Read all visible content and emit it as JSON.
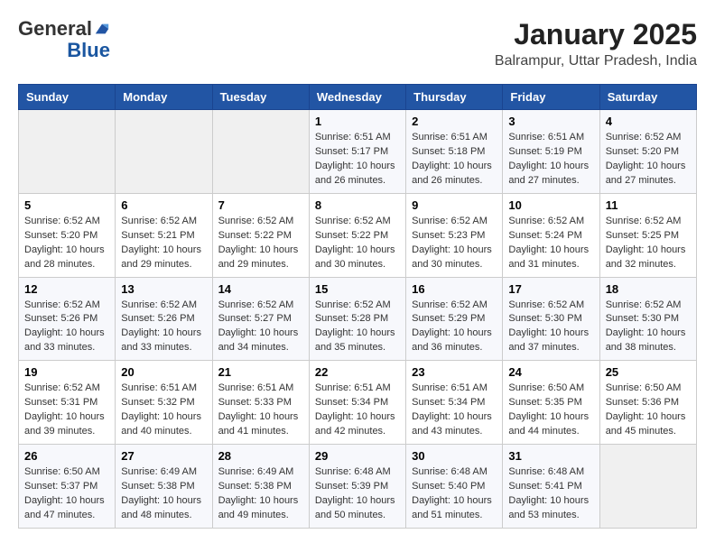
{
  "header": {
    "logo_general": "General",
    "logo_blue": "Blue",
    "month_year": "January 2025",
    "location": "Balrampur, Uttar Pradesh, India"
  },
  "days_of_week": [
    "Sunday",
    "Monday",
    "Tuesday",
    "Wednesday",
    "Thursday",
    "Friday",
    "Saturday"
  ],
  "weeks": [
    [
      {
        "day": "",
        "info": ""
      },
      {
        "day": "",
        "info": ""
      },
      {
        "day": "",
        "info": ""
      },
      {
        "day": "1",
        "info": "Sunrise: 6:51 AM\nSunset: 5:17 PM\nDaylight: 10 hours\nand 26 minutes."
      },
      {
        "day": "2",
        "info": "Sunrise: 6:51 AM\nSunset: 5:18 PM\nDaylight: 10 hours\nand 26 minutes."
      },
      {
        "day": "3",
        "info": "Sunrise: 6:51 AM\nSunset: 5:19 PM\nDaylight: 10 hours\nand 27 minutes."
      },
      {
        "day": "4",
        "info": "Sunrise: 6:52 AM\nSunset: 5:20 PM\nDaylight: 10 hours\nand 27 minutes."
      }
    ],
    [
      {
        "day": "5",
        "info": "Sunrise: 6:52 AM\nSunset: 5:20 PM\nDaylight: 10 hours\nand 28 minutes."
      },
      {
        "day": "6",
        "info": "Sunrise: 6:52 AM\nSunset: 5:21 PM\nDaylight: 10 hours\nand 29 minutes."
      },
      {
        "day": "7",
        "info": "Sunrise: 6:52 AM\nSunset: 5:22 PM\nDaylight: 10 hours\nand 29 minutes."
      },
      {
        "day": "8",
        "info": "Sunrise: 6:52 AM\nSunset: 5:22 PM\nDaylight: 10 hours\nand 30 minutes."
      },
      {
        "day": "9",
        "info": "Sunrise: 6:52 AM\nSunset: 5:23 PM\nDaylight: 10 hours\nand 30 minutes."
      },
      {
        "day": "10",
        "info": "Sunrise: 6:52 AM\nSunset: 5:24 PM\nDaylight: 10 hours\nand 31 minutes."
      },
      {
        "day": "11",
        "info": "Sunrise: 6:52 AM\nSunset: 5:25 PM\nDaylight: 10 hours\nand 32 minutes."
      }
    ],
    [
      {
        "day": "12",
        "info": "Sunrise: 6:52 AM\nSunset: 5:26 PM\nDaylight: 10 hours\nand 33 minutes."
      },
      {
        "day": "13",
        "info": "Sunrise: 6:52 AM\nSunset: 5:26 PM\nDaylight: 10 hours\nand 33 minutes."
      },
      {
        "day": "14",
        "info": "Sunrise: 6:52 AM\nSunset: 5:27 PM\nDaylight: 10 hours\nand 34 minutes."
      },
      {
        "day": "15",
        "info": "Sunrise: 6:52 AM\nSunset: 5:28 PM\nDaylight: 10 hours\nand 35 minutes."
      },
      {
        "day": "16",
        "info": "Sunrise: 6:52 AM\nSunset: 5:29 PM\nDaylight: 10 hours\nand 36 minutes."
      },
      {
        "day": "17",
        "info": "Sunrise: 6:52 AM\nSunset: 5:30 PM\nDaylight: 10 hours\nand 37 minutes."
      },
      {
        "day": "18",
        "info": "Sunrise: 6:52 AM\nSunset: 5:30 PM\nDaylight: 10 hours\nand 38 minutes."
      }
    ],
    [
      {
        "day": "19",
        "info": "Sunrise: 6:52 AM\nSunset: 5:31 PM\nDaylight: 10 hours\nand 39 minutes."
      },
      {
        "day": "20",
        "info": "Sunrise: 6:51 AM\nSunset: 5:32 PM\nDaylight: 10 hours\nand 40 minutes."
      },
      {
        "day": "21",
        "info": "Sunrise: 6:51 AM\nSunset: 5:33 PM\nDaylight: 10 hours\nand 41 minutes."
      },
      {
        "day": "22",
        "info": "Sunrise: 6:51 AM\nSunset: 5:34 PM\nDaylight: 10 hours\nand 42 minutes."
      },
      {
        "day": "23",
        "info": "Sunrise: 6:51 AM\nSunset: 5:34 PM\nDaylight: 10 hours\nand 43 minutes."
      },
      {
        "day": "24",
        "info": "Sunrise: 6:50 AM\nSunset: 5:35 PM\nDaylight: 10 hours\nand 44 minutes."
      },
      {
        "day": "25",
        "info": "Sunrise: 6:50 AM\nSunset: 5:36 PM\nDaylight: 10 hours\nand 45 minutes."
      }
    ],
    [
      {
        "day": "26",
        "info": "Sunrise: 6:50 AM\nSunset: 5:37 PM\nDaylight: 10 hours\nand 47 minutes."
      },
      {
        "day": "27",
        "info": "Sunrise: 6:49 AM\nSunset: 5:38 PM\nDaylight: 10 hours\nand 48 minutes."
      },
      {
        "day": "28",
        "info": "Sunrise: 6:49 AM\nSunset: 5:38 PM\nDaylight: 10 hours\nand 49 minutes."
      },
      {
        "day": "29",
        "info": "Sunrise: 6:48 AM\nSunset: 5:39 PM\nDaylight: 10 hours\nand 50 minutes."
      },
      {
        "day": "30",
        "info": "Sunrise: 6:48 AM\nSunset: 5:40 PM\nDaylight: 10 hours\nand 51 minutes."
      },
      {
        "day": "31",
        "info": "Sunrise: 6:48 AM\nSunset: 5:41 PM\nDaylight: 10 hours\nand 53 minutes."
      },
      {
        "day": "",
        "info": ""
      }
    ]
  ]
}
